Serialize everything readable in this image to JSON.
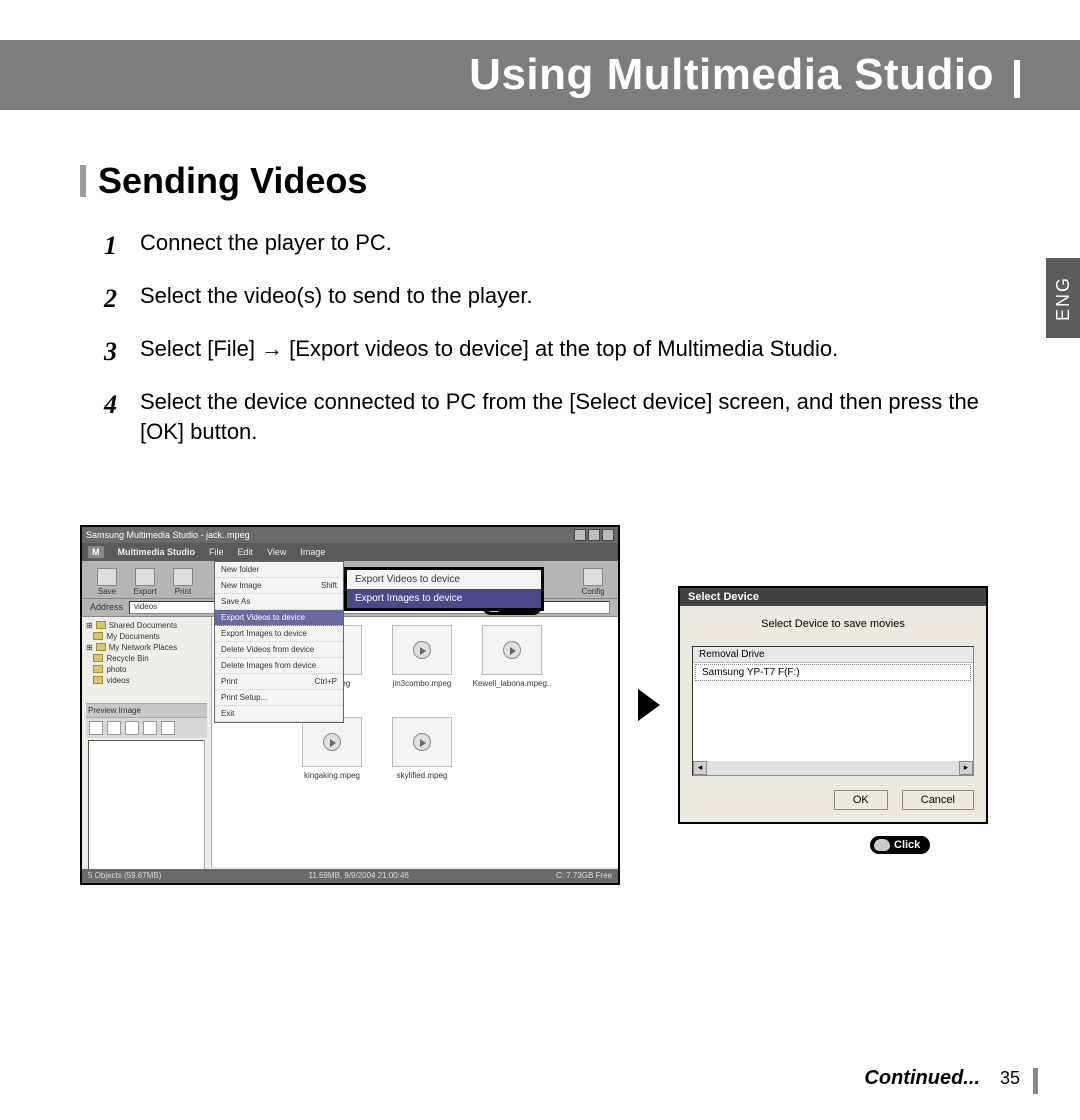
{
  "header": {
    "title": "Using Multimedia Studio"
  },
  "lang_tab": "ENG",
  "section": {
    "title": "Sending Videos"
  },
  "steps": [
    {
      "num": "1",
      "text": "Connect the player to PC."
    },
    {
      "num": "2",
      "text": "Select the video(s) to send to the player."
    },
    {
      "num": "3",
      "text": "Select [File]  →  [Export videos to device] at the top of Multimedia Studio."
    },
    {
      "num": "4",
      "text": "Select the device connected to PC from the [Select device] screen, and then press the [OK] button."
    }
  ],
  "app": {
    "title": "Samsung Multimedia Studio - jack..mpeg",
    "brand": "Multimedia Studio",
    "menu": [
      "File",
      "Edit",
      "View",
      "Image"
    ],
    "toolbar": [
      "Save",
      "Export",
      "Print"
    ],
    "toolbar_right": "Config",
    "address_label": "Address",
    "address_value": "videos",
    "tree": [
      "Shared Documents",
      "My Documents",
      "My Network Places",
      "Recycle Bin",
      "photo",
      "videos"
    ],
    "preview_label": "Preview Image",
    "thumbs": [
      "jack.mpeg",
      "jin3combo.mpeg",
      "Kewell_labona.mpeg..",
      "kingaking.mpeg",
      "skylified.mpeg"
    ],
    "dropdown": {
      "items": [
        {
          "label": "New folder",
          "shortcut": ""
        },
        {
          "label": "New Image",
          "shortcut": "Shift"
        },
        {
          "label": "Save As",
          "shortcut": ""
        },
        {
          "label": "Export Videos to device",
          "shortcut": "",
          "highlight": true
        },
        {
          "label": "Export Images to device",
          "shortcut": ""
        },
        {
          "label": "Delete Videos from device",
          "shortcut": ""
        },
        {
          "label": "Delete Images from device",
          "shortcut": ""
        },
        {
          "label": "Print",
          "shortcut": "Ctrl+P"
        },
        {
          "label": "Print Setup...",
          "shortcut": ""
        },
        {
          "label": "Exit",
          "shortcut": ""
        }
      ]
    },
    "submenu": {
      "items": [
        {
          "label": "Export Videos to device"
        },
        {
          "label": "Export Images to device",
          "highlight": true
        }
      ]
    },
    "click_label": "Click",
    "status_left": "5 Objects (59.67MB)",
    "status_mid": "11.69MB, 9/9/2004 21:00:46",
    "status_right": "C: 7.73GB Free"
  },
  "dialog": {
    "title": "Select Device",
    "text": "Select Device to save movies",
    "column": "Removal Drive",
    "item": "Samsung YP-T7 F(F:)",
    "ok": "OK",
    "cancel": "Cancel",
    "click_label": "Click"
  },
  "footer": {
    "continued": "Continued...",
    "page": "35"
  }
}
